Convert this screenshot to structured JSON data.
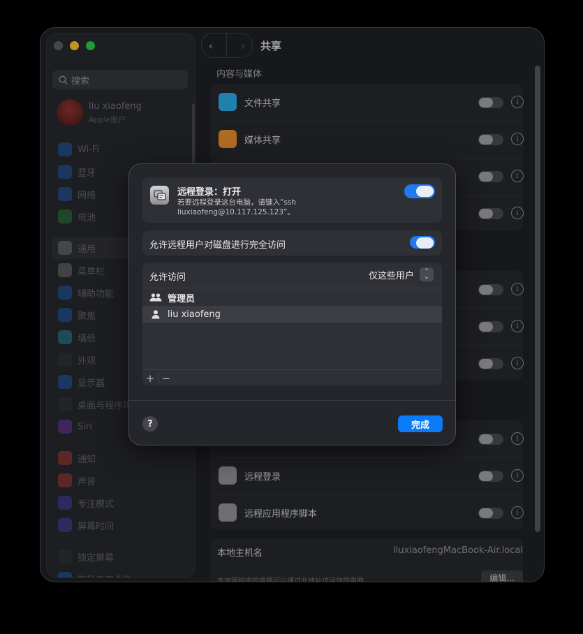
{
  "sidebar": {
    "search_placeholder": "搜索",
    "account": {
      "name": "liu xiaofeng",
      "subtitle": "Apple账户"
    },
    "groups": [
      [
        {
          "label": "Wi-Fi",
          "icon": "wifi-icon",
          "color": "#1e6fd9"
        },
        {
          "label": "蓝牙",
          "icon": "bluetooth-icon",
          "color": "#1e6fd9"
        },
        {
          "label": "网络",
          "icon": "globe-icon",
          "color": "#1e6fd9"
        },
        {
          "label": "电池",
          "icon": "battery-icon",
          "color": "#2f9e44"
        }
      ],
      [
        {
          "label": "通用",
          "icon": "gear-icon",
          "color": "#8e8e93",
          "active": true
        },
        {
          "label": "菜单栏",
          "icon": "menubar-icon",
          "color": "#8e8e93"
        },
        {
          "label": "辅助功能",
          "icon": "accessibility-icon",
          "color": "#1e6fd9"
        },
        {
          "label": "聚焦",
          "icon": "spotlight-icon",
          "color": "#1e6fd9"
        },
        {
          "label": "墙纸",
          "icon": "wallpaper-icon",
          "color": "#2aa6c8"
        },
        {
          "label": "外观",
          "icon": "appearance-icon",
          "color": "#3a3a3c"
        },
        {
          "label": "显示器",
          "icon": "display-icon",
          "color": "#1e6fd9"
        },
        {
          "label": "桌面与程序坞",
          "icon": "dock-icon",
          "color": "#3a3a3c"
        },
        {
          "label": "Siri",
          "icon": "siri-icon",
          "color": "#8a3fd1"
        }
      ],
      [
        {
          "label": "通知",
          "icon": "notifications-icon",
          "color": "#e0413a"
        },
        {
          "label": "声音",
          "icon": "sound-icon",
          "color": "#e0413a"
        },
        {
          "label": "专注模式",
          "icon": "focus-icon",
          "color": "#5b47d6"
        },
        {
          "label": "屏幕时间",
          "icon": "screentime-icon",
          "color": "#5b47d6"
        }
      ],
      [
        {
          "label": "锁定屏幕",
          "icon": "lock-icon",
          "color": "#3a3a3c"
        },
        {
          "label": "隐私与安全性",
          "icon": "privacy-icon",
          "color": "#1e6fd9"
        }
      ]
    ]
  },
  "main": {
    "title": "共享",
    "section_content_media": "内容与媒体",
    "rows_top": [
      {
        "label": "文件共享",
        "icon": "folder-icon",
        "color": "#2aa6e0"
      },
      {
        "label": "媒体共享",
        "icon": "media-icon",
        "color": "#e08a2a"
      },
      {
        "label": "",
        "icon": "",
        "color": ""
      },
      {
        "label": "",
        "icon": "",
        "color": ""
      }
    ],
    "rows_mid": [
      {
        "label": "",
        "icon": ""
      },
      {
        "label": "",
        "icon": ""
      },
      {
        "label": "",
        "icon": ""
      }
    ],
    "rows_bottom": [
      {
        "label": "",
        "icon": ""
      },
      {
        "label": "远程登录",
        "icon": "remote-login-icon",
        "color": "#8e8e93"
      },
      {
        "label": "远程应用程序脚本",
        "icon": "script-icon",
        "color": "#8e8e93"
      }
    ],
    "host": {
      "label": "本地主机名",
      "value": "liuxiaofengMacBook-Air.local",
      "description": "本地网络中的电脑可以通过此地址访问你的电脑。",
      "edit_label": "编辑..."
    }
  },
  "sheet": {
    "remote_login": {
      "title": "远程登录：打开",
      "description": "若要远程登录这台电脑，请键入“ssh liuxiaofeng@10.117.125.123”。",
      "enabled": true
    },
    "full_disk": {
      "label": "允许远程用户对磁盘进行完全访问",
      "enabled": true
    },
    "access": {
      "label": "允许访问",
      "selected_option": "仅这些用户",
      "users": [
        {
          "name": "管理员",
          "icon": "group-icon",
          "bold": true
        },
        {
          "name": "liu xiaofeng",
          "icon": "person-icon",
          "selected": true
        }
      ],
      "add_label": "+",
      "remove_label": "−"
    },
    "help_label": "?",
    "done_label": "完成",
    "accent_color": "#0b7af5"
  }
}
